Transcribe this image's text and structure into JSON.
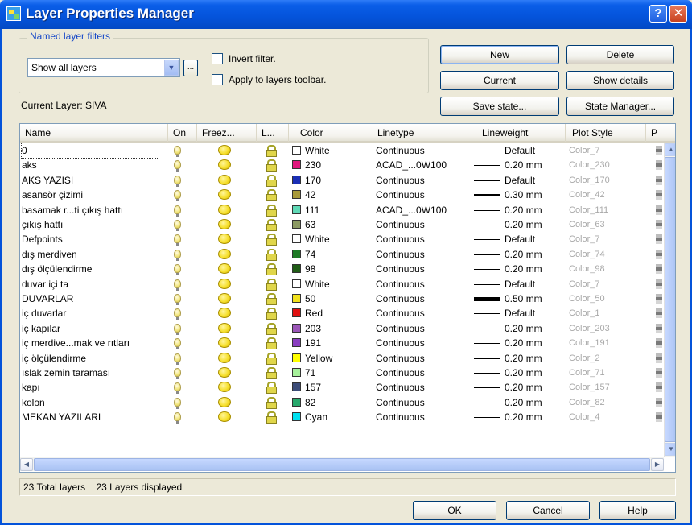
{
  "window": {
    "title": "Layer Properties Manager"
  },
  "filters": {
    "group_label": "Named layer filters",
    "selected": "Show all layers",
    "browse_label": "...",
    "invert_label": "Invert filter.",
    "apply_label": "Apply to layers toolbar."
  },
  "buttons": {
    "new": "New",
    "delete": "Delete",
    "current": "Current",
    "show_details": "Show details",
    "save_state": "Save state...",
    "state_manager": "State Manager...",
    "ok": "OK",
    "cancel": "Cancel",
    "help": "Help"
  },
  "current_layer": {
    "label": "Current Layer:",
    "value": "SIVA"
  },
  "columns": [
    "Name",
    "On",
    "Freez...",
    "L...",
    "Color",
    "Linetype",
    "Lineweight",
    "Plot Style",
    "P"
  ],
  "layers": [
    {
      "name": "0",
      "color_name": "White",
      "color_hex": "#ffffff",
      "linetype": "Continuous",
      "lineweight": "Default",
      "plot_style": "Color_7",
      "thickness": "thin"
    },
    {
      "name": "aks",
      "color_name": "230",
      "color_hex": "#e0177d",
      "linetype": "ACAD_...0W100",
      "lineweight": "0.20 mm",
      "plot_style": "Color_230",
      "thickness": "thin"
    },
    {
      "name": "AKS YAZISI",
      "color_name": "170",
      "color_hex": "#1a2fb6",
      "linetype": "Continuous",
      "lineweight": "Default",
      "plot_style": "Color_170",
      "thickness": "thin"
    },
    {
      "name": "asansör çizimi",
      "color_name": "42",
      "color_hex": "#a89a3a",
      "linetype": "Continuous",
      "lineweight": "0.30 mm",
      "plot_style": "Color_42",
      "thickness": "thick3"
    },
    {
      "name": "basamak  r...ti çıkış  hattı",
      "color_name": "111",
      "color_hex": "#5fd9b6",
      "linetype": "ACAD_...0W100",
      "lineweight": "0.20 mm",
      "plot_style": "Color_111",
      "thickness": "thin"
    },
    {
      "name": "çıkış hattı",
      "color_name": "63",
      "color_hex": "#8c9a63",
      "linetype": "Continuous",
      "lineweight": "0.20 mm",
      "plot_style": "Color_63",
      "thickness": "thin"
    },
    {
      "name": "Defpoints",
      "color_name": "White",
      "color_hex": "#ffffff",
      "linetype": "Continuous",
      "lineweight": "Default",
      "plot_style": "Color_7",
      "thickness": "thin"
    },
    {
      "name": "dış merdiven",
      "color_name": "74",
      "color_hex": "#1d7a25",
      "linetype": "Continuous",
      "lineweight": "0.20 mm",
      "plot_style": "Color_74",
      "thickness": "thin"
    },
    {
      "name": "dış ölçülendirme",
      "color_name": "98",
      "color_hex": "#1f5c16",
      "linetype": "Continuous",
      "lineweight": "0.20 mm",
      "plot_style": "Color_98",
      "thickness": "thin"
    },
    {
      "name": "duvar içi ta",
      "color_name": "White",
      "color_hex": "#ffffff",
      "linetype": "Continuous",
      "lineweight": "Default",
      "plot_style": "Color_7",
      "thickness": "thin"
    },
    {
      "name": "DUVARLAR",
      "color_name": "50",
      "color_hex": "#f2e21d",
      "linetype": "Continuous",
      "lineweight": "0.50 mm",
      "plot_style": "Color_50",
      "thickness": "thick5"
    },
    {
      "name": "iç duvarlar",
      "color_name": "Red",
      "color_hex": "#e01010",
      "linetype": "Continuous",
      "lineweight": "Default",
      "plot_style": "Color_1",
      "thickness": "thin"
    },
    {
      "name": "iç kapılar",
      "color_name": "203",
      "color_hex": "#9b56b8",
      "linetype": "Continuous",
      "lineweight": "0.20 mm",
      "plot_style": "Color_203",
      "thickness": "thin"
    },
    {
      "name": "iç merdive...mak ve rıtları",
      "color_name": "191",
      "color_hex": "#8a3ec1",
      "linetype": "Continuous",
      "lineweight": "0.20 mm",
      "plot_style": "Color_191",
      "thickness": "thin"
    },
    {
      "name": "iç ölçülendirme",
      "color_name": "Yellow",
      "color_hex": "#ffff00",
      "linetype": "Continuous",
      "lineweight": "0.20 mm",
      "plot_style": "Color_2",
      "thickness": "thin"
    },
    {
      "name": "ıslak zemin taraması",
      "color_name": "71",
      "color_hex": "#a6f09a",
      "linetype": "Continuous",
      "lineweight": "0.20 mm",
      "plot_style": "Color_71",
      "thickness": "thin"
    },
    {
      "name": "kapı",
      "color_name": "157",
      "color_hex": "#3c4c78",
      "linetype": "Continuous",
      "lineweight": "0.20 mm",
      "plot_style": "Color_157",
      "thickness": "thin"
    },
    {
      "name": "kolon",
      "color_name": "82",
      "color_hex": "#27a86b",
      "linetype": "Continuous",
      "lineweight": "0.20 mm",
      "plot_style": "Color_82",
      "thickness": "thin"
    },
    {
      "name": "MEKAN YAZILARI",
      "color_name": "Cyan",
      "color_hex": "#00e0f0",
      "linetype": "Continuous",
      "lineweight": "0.20 mm",
      "plot_style": "Color_4",
      "thickness": "thin"
    }
  ],
  "status": {
    "total": "23 Total layers",
    "displayed": "23 Layers displayed"
  }
}
